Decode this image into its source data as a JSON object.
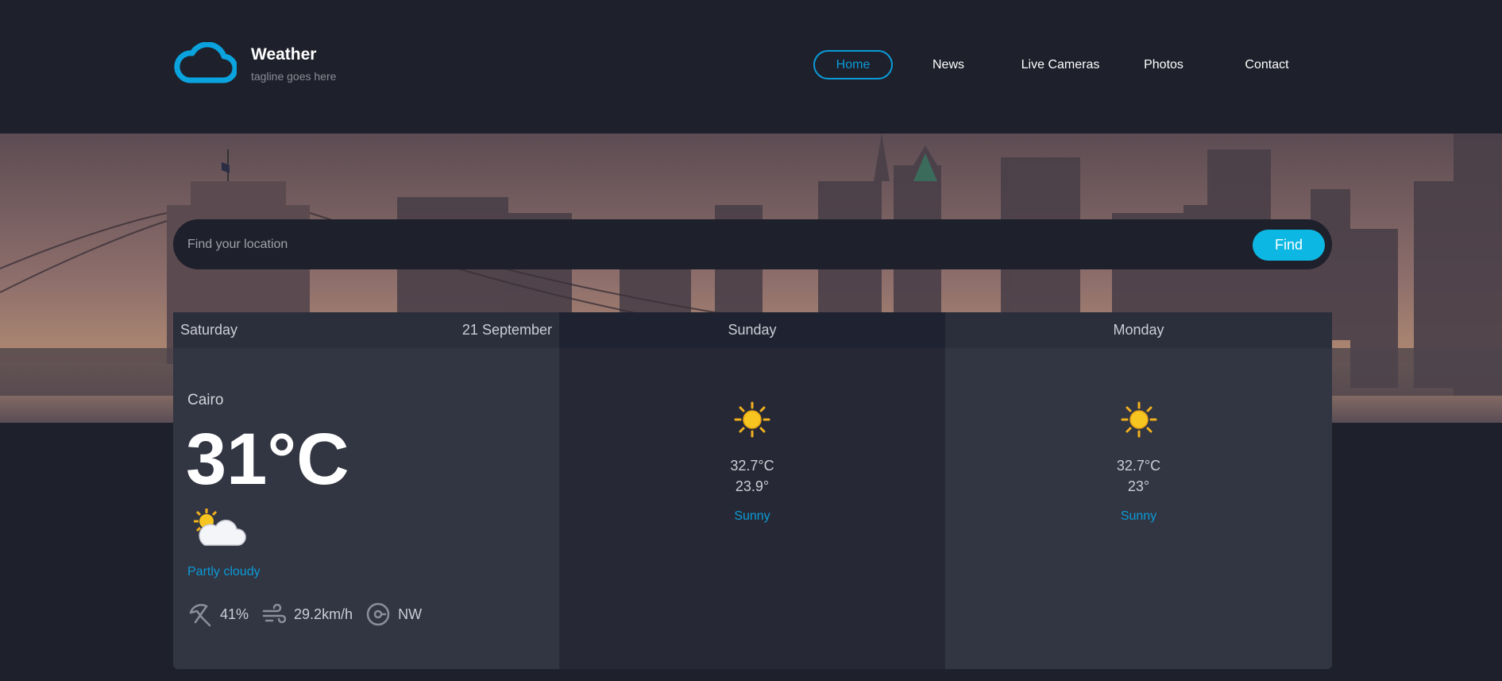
{
  "brand": {
    "title": "Weather",
    "tagline": "tagline goes here",
    "logo_icon": "cloud-icon"
  },
  "nav": {
    "items": [
      {
        "label": "Home",
        "active": true
      },
      {
        "label": "News"
      },
      {
        "label": "Live Cameras"
      },
      {
        "label": "Photos"
      },
      {
        "label": "Contact"
      }
    ]
  },
  "search": {
    "placeholder": "Find your location",
    "value": "",
    "button": "Find"
  },
  "today": {
    "day": "Saturday",
    "date": "21 September",
    "city": "Cairo",
    "temperature": "31°C",
    "condition": "Partly cloudy",
    "condition_icon": "partly-cloudy-icon",
    "humidity": "41%",
    "wind_speed": "29.2km/h",
    "wind_direction": "NW"
  },
  "days": [
    {
      "day": "Sunday",
      "high": "32.7°C",
      "low": "23.9°",
      "condition": "Sunny",
      "icon": "sun-icon"
    },
    {
      "day": "Monday",
      "high": "32.7°C",
      "low": "23°",
      "condition": "Sunny",
      "icon": "sun-icon"
    }
  ],
  "colors": {
    "accent": "#0b9bd8",
    "button": "#0cb8e3",
    "background": "#1e202b"
  }
}
